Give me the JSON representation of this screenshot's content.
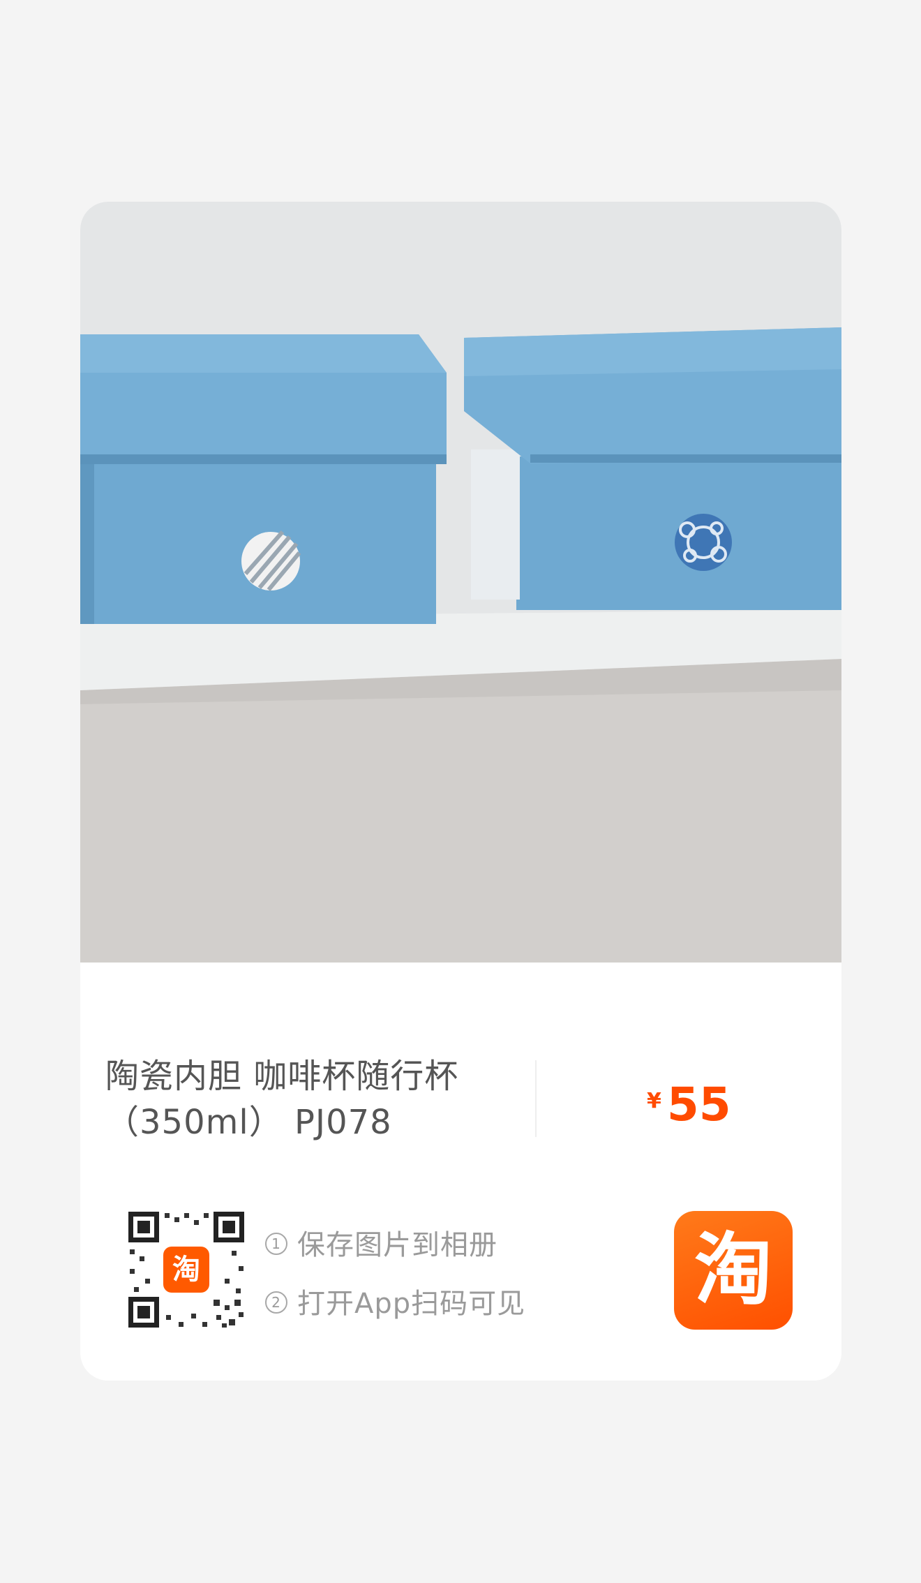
{
  "product": {
    "title": "陶瓷内胆 咖啡杯随行杯（350ml） PJ078",
    "currency": "¥",
    "price": "55"
  },
  "share": {
    "step1_num": "1",
    "step1_text": "保存图片到相册",
    "step2_num": "2",
    "step2_text": "打开App扫码可见",
    "qr_badge": "淘",
    "app_logo_glyph": "淘"
  },
  "colors": {
    "price": "#ff4b00",
    "brand": "#ff5000",
    "box_blue": "#6fa8d0"
  },
  "icons": {
    "qr": "qr-code-icon",
    "app": "taobao-app-icon"
  }
}
